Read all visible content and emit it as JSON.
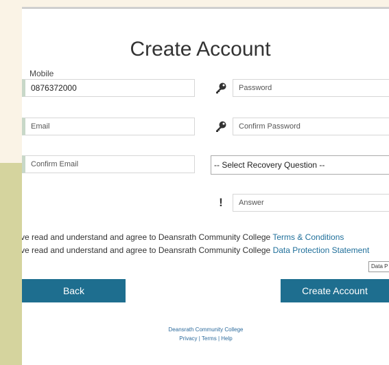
{
  "title": "Create Account",
  "form": {
    "mobile_label": "Mobile",
    "mobile_value": "0876372000",
    "email_placeholder": "Email",
    "confirm_email_placeholder": "Confirm Email",
    "password_placeholder": "Password",
    "confirm_password_placeholder": "Confirm Password",
    "recovery_question_selected": "-- Select Recovery Question --",
    "answer_placeholder": "Answer"
  },
  "icons": {
    "password": "key-icon",
    "confirm_password": "key-icon",
    "answer": "exclamation-icon"
  },
  "consents": [
    {
      "text": "ve read and understand and agree to Deansrath Community College ",
      "link": "Terms & Conditions"
    },
    {
      "text": "ve read and understand and agree to Deansrath Community College ",
      "link": "Data Protection Statement"
    }
  ],
  "tooltip": "Data P",
  "buttons": {
    "back": "Back",
    "create_account": "Create Account"
  },
  "footer": {
    "college": "Deansrath Community College",
    "privacy": "Privacy",
    "terms": "Terms",
    "help": "Help",
    "separator": "|"
  },
  "colors": {
    "button": "#1e6e8f",
    "link": "#1f6f9a",
    "background_olive": "#d5d49e",
    "background_cream": "#faf3e6"
  }
}
